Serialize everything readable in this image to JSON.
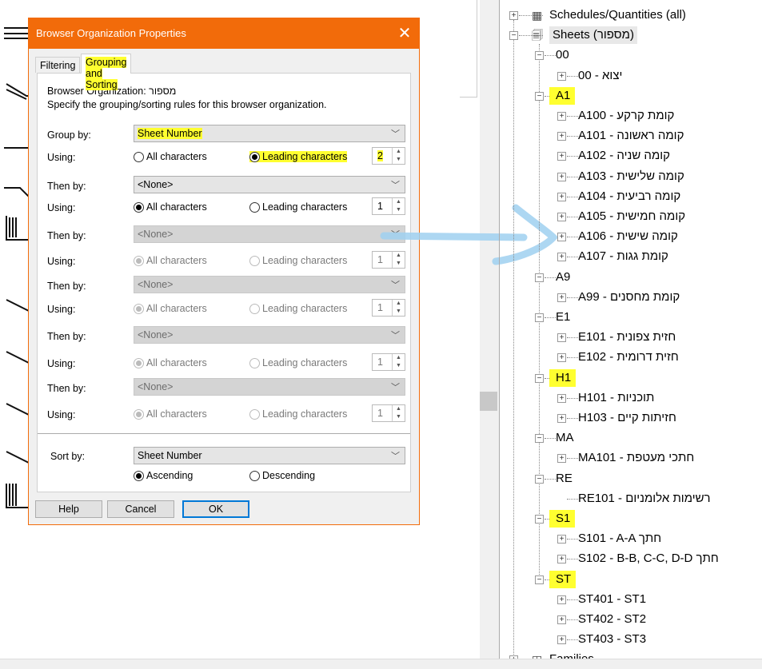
{
  "dialog": {
    "title": "Browser Organization Properties",
    "tabs": [
      "Filtering",
      "Grouping and Sorting"
    ],
    "org_label": "Browser Organization: מספור",
    "instructions": "Specify the grouping/sorting rules for this browser organization.",
    "group_by_label": "Group by:",
    "group_by_value": "Sheet Number",
    "using_label": "Using:",
    "then_by_label": "Then by:",
    "all_characters": "All characters",
    "leading_characters": "Leading characters",
    "group_leading_count": "2",
    "then_by": [
      {
        "value": "<None>",
        "count": "1",
        "enabled": true
      },
      {
        "value": "<None>",
        "count": "1",
        "enabled": false
      },
      {
        "value": "<None>",
        "count": "1",
        "enabled": false
      },
      {
        "value": "<None>",
        "count": "1",
        "enabled": false
      },
      {
        "value": "<None>",
        "count": "1",
        "enabled": false
      }
    ],
    "sort_by_label": "Sort by:",
    "sort_by_value": "Sheet Number",
    "ascending": "Ascending",
    "descending": "Descending",
    "sort_order": "ascending",
    "buttons": {
      "help": "Help",
      "cancel": "Cancel",
      "ok": "OK"
    },
    "highlight_color": "#ffff30",
    "title_color": "#f26b0a"
  },
  "tree": {
    "items": [
      {
        "level": 0,
        "label": "Schedules/Quantities (all)",
        "exp": "+",
        "icon": "schedule-icon"
      },
      {
        "level": 0,
        "label": "Sheets (מספור)",
        "exp": "-",
        "icon": "sheet-icon"
      },
      {
        "level": 1,
        "label": "00",
        "exp": "-"
      },
      {
        "level": 2,
        "label": "00 - יצוא",
        "exp": "+"
      },
      {
        "level": 1,
        "label": "A1",
        "exp": "-",
        "hl": true
      },
      {
        "level": 2,
        "label": "A100 - קומת קרקע",
        "exp": "+"
      },
      {
        "level": 2,
        "label": "A101 - קומה ראשונה",
        "exp": "+"
      },
      {
        "level": 2,
        "label": "A102 - קומה שניה",
        "exp": "+"
      },
      {
        "level": 2,
        "label": "A103 - קומה שלישית",
        "exp": "+"
      },
      {
        "level": 2,
        "label": "A104 - קומה רביעית",
        "exp": "+"
      },
      {
        "level": 2,
        "label": "A105 - קומה חמישית",
        "exp": "+"
      },
      {
        "level": 2,
        "label": "A106 - קומה שישית",
        "exp": "+"
      },
      {
        "level": 2,
        "label": "A107 - קומת גגות",
        "exp": "+"
      },
      {
        "level": 1,
        "label": "A9",
        "exp": "-"
      },
      {
        "level": 2,
        "label": "A99 - קומת מחסנים",
        "exp": "+"
      },
      {
        "level": 1,
        "label": "E1",
        "exp": "-"
      },
      {
        "level": 2,
        "label": "E101 - חזית צפונית",
        "exp": "+"
      },
      {
        "level": 2,
        "label": "E102 - חזית דרומית",
        "exp": "+"
      },
      {
        "level": 1,
        "label": "H1",
        "exp": "-",
        "hl": true
      },
      {
        "level": 2,
        "label": "H101 - תוכניות",
        "exp": "+"
      },
      {
        "level": 2,
        "label": "H103 - חזיתות קיים",
        "exp": "+"
      },
      {
        "level": 1,
        "label": "MA",
        "exp": "-"
      },
      {
        "level": 2,
        "label": "MA101 - חתכי מעטפת",
        "exp": "+"
      },
      {
        "level": 1,
        "label": "RE",
        "exp": "-"
      },
      {
        "level": 2,
        "label": "RE101 - רשימות אלומניום",
        "exp": ""
      },
      {
        "level": 1,
        "label": "S1",
        "exp": "-",
        "hl": true
      },
      {
        "level": 2,
        "label": "S101 - A-A חתך",
        "exp": "+"
      },
      {
        "level": 2,
        "label": "S102 - B-B, C-C, D-D חתך",
        "exp": "+"
      },
      {
        "level": 1,
        "label": "ST",
        "exp": "-",
        "hl": true
      },
      {
        "level": 2,
        "label": "ST401 - ST1",
        "exp": "+"
      },
      {
        "level": 2,
        "label": "ST402 - ST2",
        "exp": "+"
      },
      {
        "level": 2,
        "label": "ST403 - ST3",
        "exp": "+"
      },
      {
        "level": 0,
        "label": "Families",
        "exp": "+",
        "icon": "family-icon"
      }
    ]
  },
  "annotation": {
    "arrow_color": "#9fd0f0"
  }
}
